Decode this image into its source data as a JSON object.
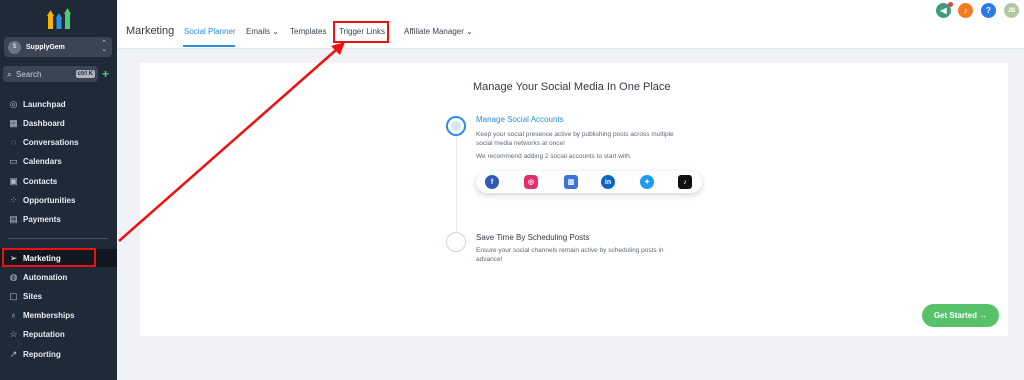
{
  "sidebar": {
    "account": {
      "avatar_text": "S",
      "name": "SupplyGem"
    },
    "search": {
      "placeholder": "Search",
      "shortcut": "ctrl K"
    },
    "items": [
      {
        "label": "Launchpad",
        "icon": "rocket-icon"
      },
      {
        "label": "Dashboard",
        "icon": "grid-icon"
      },
      {
        "label": "Conversations",
        "icon": "chat-icon"
      },
      {
        "label": "Calendars",
        "icon": "calendar-icon"
      },
      {
        "label": "Contacts",
        "icon": "contacts-icon"
      },
      {
        "label": "Opportunities",
        "icon": "filter-icon"
      },
      {
        "label": "Payments",
        "icon": "payment-icon"
      },
      {
        "label": "Marketing",
        "icon": "send-icon",
        "active": true
      },
      {
        "label": "Automation",
        "icon": "automation-icon"
      },
      {
        "label": "Sites",
        "icon": "sites-icon"
      },
      {
        "label": "Memberships",
        "icon": "membership-icon"
      },
      {
        "label": "Reputation",
        "icon": "star-icon"
      },
      {
        "label": "Reporting",
        "icon": "chart-line-icon"
      }
    ]
  },
  "header": {
    "title": "Marketing",
    "tabs": [
      {
        "label": "Social Planner",
        "active": true
      },
      {
        "label": "Emails"
      },
      {
        "label": "Templates"
      },
      {
        "label": "Trigger Links"
      },
      {
        "label": "Affiliate Manager"
      }
    ],
    "user_initials": "JB"
  },
  "main": {
    "heading": "Manage Your Social Media In One Place",
    "step1": {
      "title": "Manage Social Accounts",
      "desc_line1": "Keep your social presence active by publishing posts across multiple",
      "desc_line2": "social media networks at once!",
      "recommend": "We recommend adding 2 social accounts to start with."
    },
    "step2": {
      "title": "Save Time By Scheduling Posts",
      "desc_line1": "Ensure your social channels remain active by scheduling posts in",
      "desc_line2": "advance!"
    },
    "socials": [
      "facebook-icon",
      "instagram-icon",
      "google-business-icon",
      "linkedin-icon",
      "twitter-icon",
      "tiktok-icon"
    ],
    "cta": "Get Started →"
  },
  "colors": {
    "accent": "#2c8fde",
    "cta": "#58c26a",
    "sidebar": "#1f2a38",
    "highlight": "#e11111"
  }
}
